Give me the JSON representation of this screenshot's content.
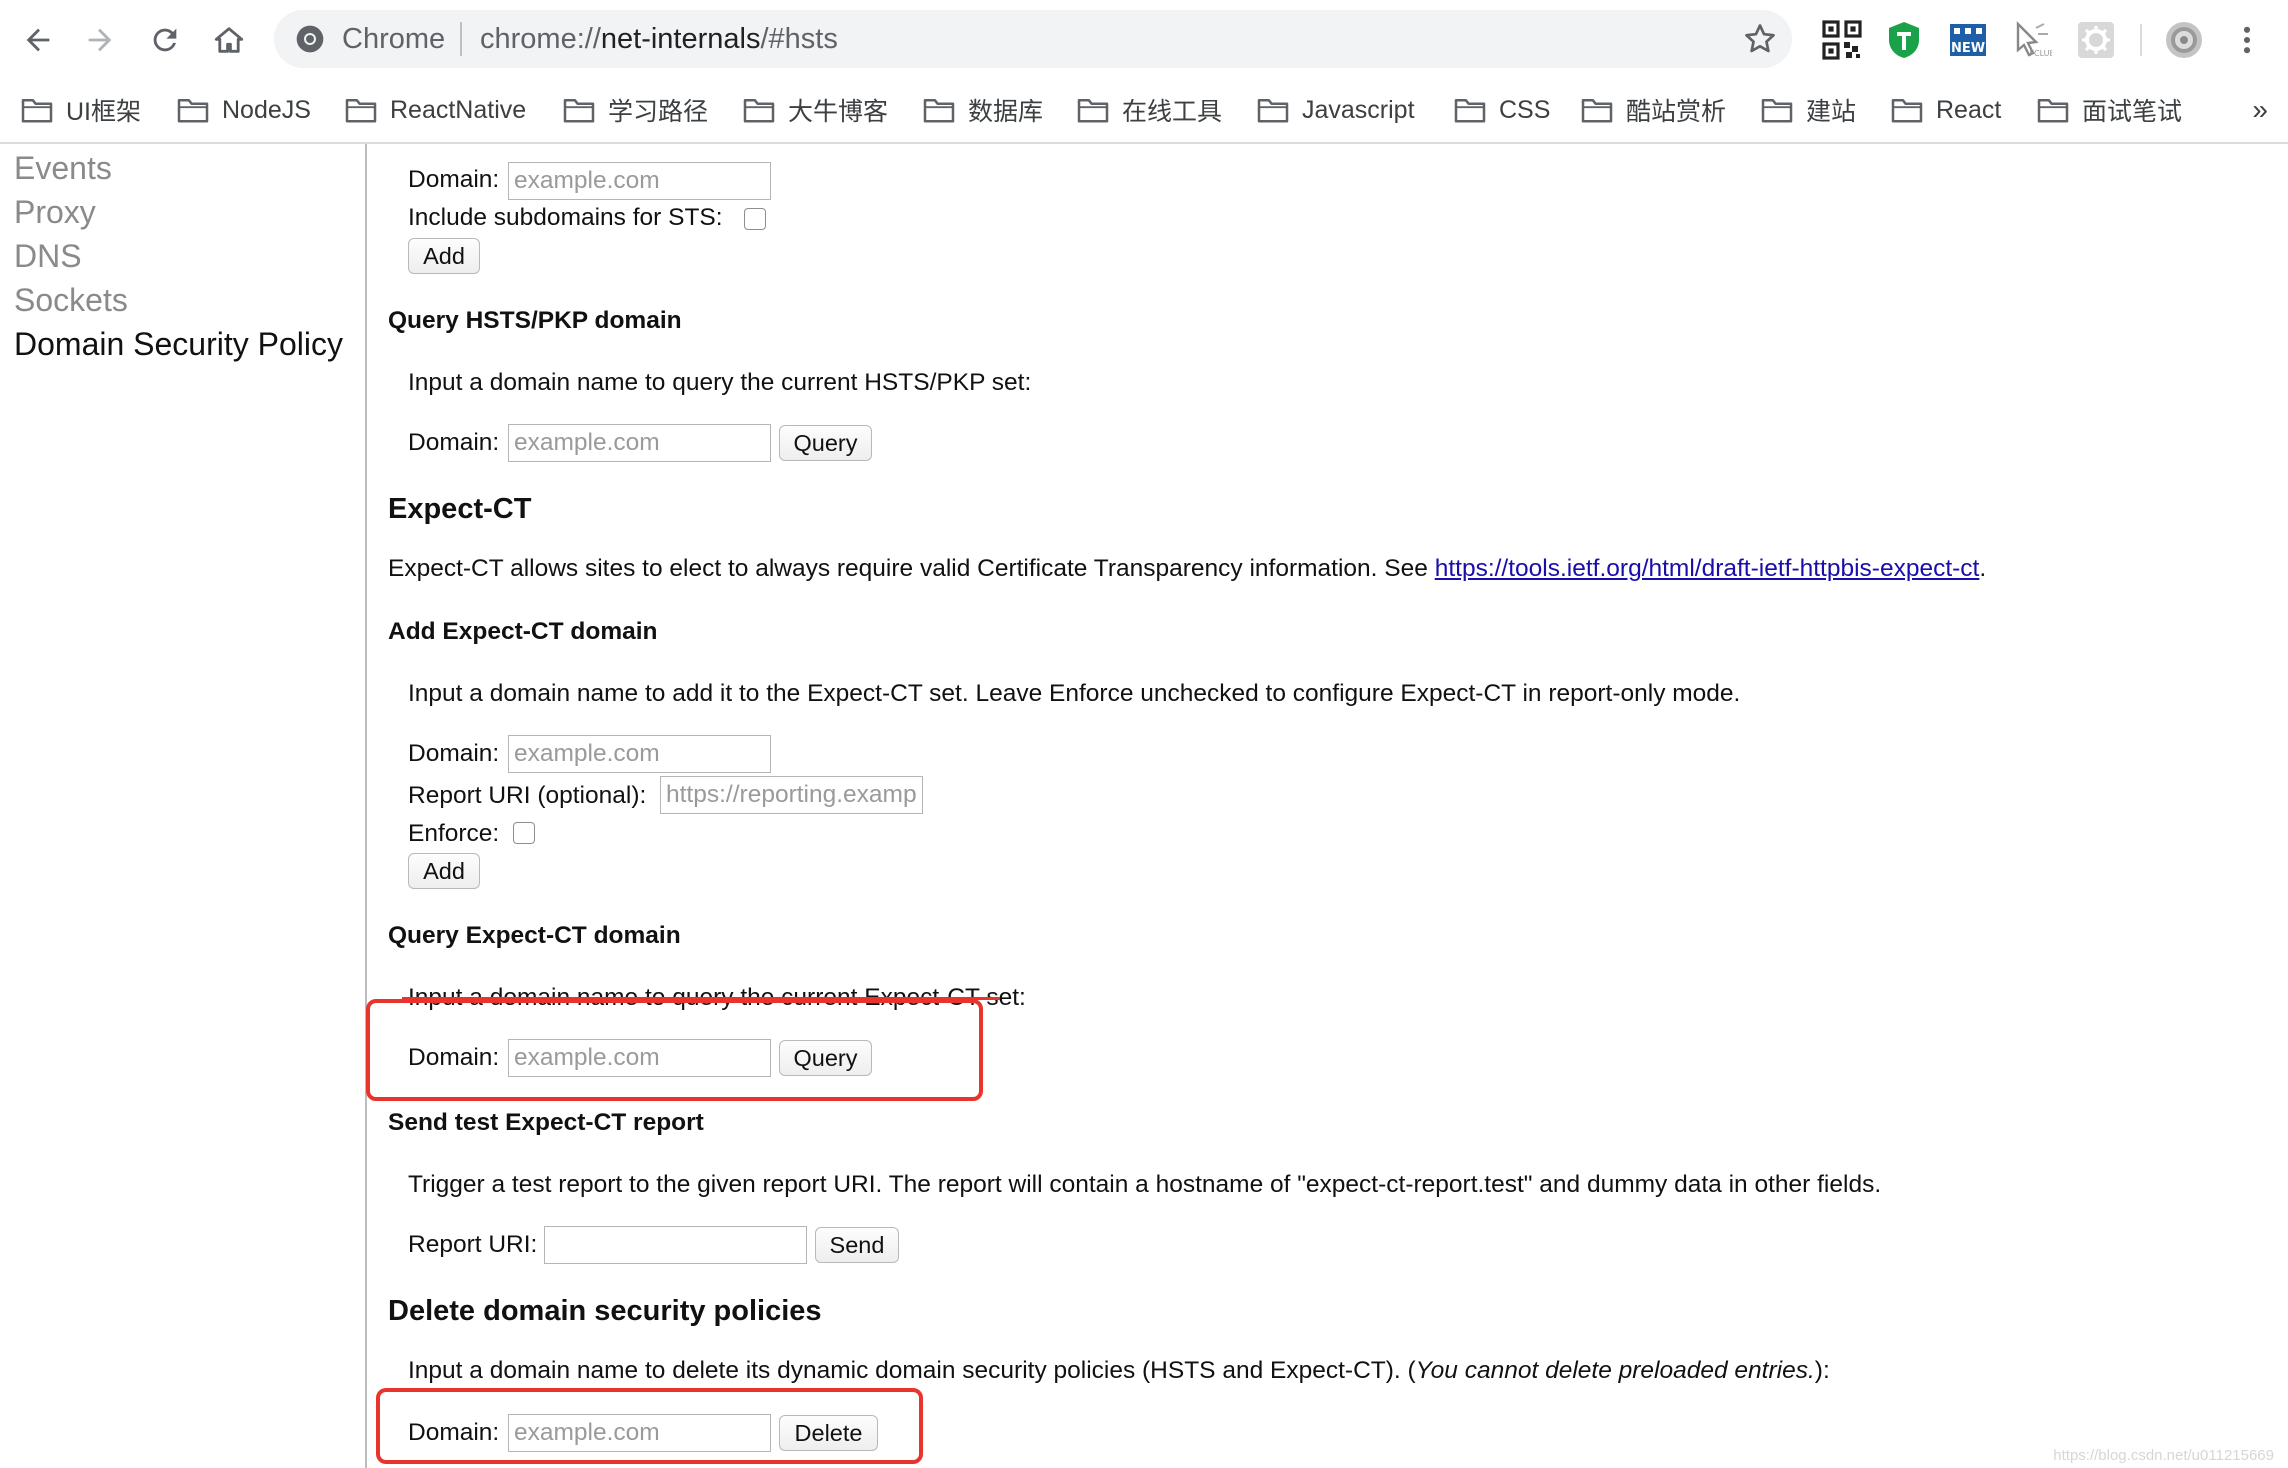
{
  "toolbar": {
    "omnibox_prefix": "Chrome",
    "url_scheme": "chrome://",
    "url_host": "net-internals",
    "url_path": "/#hsts"
  },
  "bookmarks": {
    "items": [
      "UI框架",
      "NodeJS",
      "ReactNative",
      "学习路径",
      "大牛博客",
      "数据库",
      "在线工具",
      "Javascript",
      "CSS",
      "酷站赏析",
      "建站",
      "React",
      "面试笔试"
    ],
    "more": "»"
  },
  "sidebar": {
    "items": [
      "Events",
      "Proxy",
      "DNS",
      "Sockets",
      "Domain Security Policy"
    ]
  },
  "add_hsts": {
    "domain_label": "Domain:",
    "domain_placeholder": "example.com",
    "subdomains_label": "Include subdomains for STS:",
    "add_label": "Add"
  },
  "query_hsts": {
    "title": "Query HSTS/PKP domain",
    "description": "Input a domain name to query the current HSTS/PKP set:",
    "domain_label": "Domain:",
    "domain_placeholder": "example.com",
    "query_label": "Query"
  },
  "expect_ct": {
    "title": "Expect-CT",
    "description": "Expect-CT allows sites to elect to always require valid Certificate Transparency information. See",
    "link_text": "https://tools.ietf.org/html/draft-ietf-httpbis-expect-ct",
    "after_link": "."
  },
  "add_expect_ct": {
    "title": "Add Expect-CT domain",
    "description": "Input a domain name to add it to the Expect-CT set. Leave Enforce unchecked to configure Expect-CT in report-only mode.",
    "domain_label": "Domain:",
    "domain_placeholder": "example.com",
    "report_uri_label": "Report URI (optional):",
    "report_uri_placeholder": "https://reporting.example.com",
    "enforce_label": "Enforce:",
    "add_label": "Add"
  },
  "query_expect_ct": {
    "title": "Query Expect-CT domain",
    "description": "Input a domain name to query the current Expect-CT set:",
    "domain_label": "Domain:",
    "domain_placeholder": "example.com",
    "query_label": "Query"
  },
  "send_test": {
    "title": "Send test Expect-CT report",
    "description": "Trigger a test report to the given report URI. The report will contain a hostname of \"expect-ct-report.test\" and dummy data in other fields.",
    "report_uri_label": "Report URI:",
    "send_label": "Send"
  },
  "delete_policies": {
    "title": "Delete domain security policies",
    "description_start": "Input a domain name to delete its dynamic domain security policies (HSTS and Expect-CT). (",
    "description_italic": "You cannot delete preloaded entries.",
    "description_end": "):",
    "domain_label": "Domain:",
    "domain_placeholder": "example.com",
    "delete_label": "Delete"
  },
  "watermark": "https://blog.csdn.net/u011215669",
  "colors": {
    "annotation_red": "#e8342d",
    "link_blue": "#1a0dab",
    "shield_green": "#1aa24a"
  }
}
